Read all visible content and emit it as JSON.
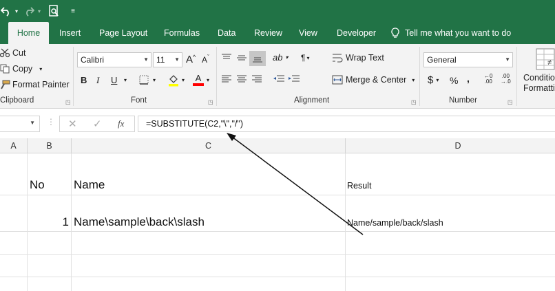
{
  "quick_access": {
    "undo": "undo-icon",
    "redo": "redo-icon",
    "print_preview": "print-preview-icon",
    "customize": "customize-qat-icon"
  },
  "tabs": [
    {
      "label": "Home",
      "active": true
    },
    {
      "label": "Insert"
    },
    {
      "label": "Page Layout"
    },
    {
      "label": "Formulas"
    },
    {
      "label": "Data"
    },
    {
      "label": "Review"
    },
    {
      "label": "View"
    },
    {
      "label": "Developer"
    }
  ],
  "tell_me": "Tell me what you want to do",
  "clipboard": {
    "cut": "Cut",
    "copy": "Copy",
    "format_painter": "Format Painter",
    "label": "Clipboard"
  },
  "font": {
    "name": "Calibri",
    "size": "11",
    "label": "Font"
  },
  "alignment": {
    "wrap_text": "Wrap Text",
    "merge_center": "Merge & Center",
    "label": "Alignment"
  },
  "number": {
    "format": "General",
    "label": "Number"
  },
  "styles": {
    "conditional_line1": "Conditio",
    "conditional_line2": "Formattin"
  },
  "formula_bar": {
    "formula": "=SUBSTITUTE(C2,\"\\\",\"/\")"
  },
  "columns": [
    "A",
    "B",
    "C",
    "D"
  ],
  "rows": [
    {
      "b": "No",
      "c": "Name",
      "d": "Result"
    },
    {
      "b": "1",
      "c": "Name\\sample\\back\\slash",
      "d": "Name/sample/back/slash"
    }
  ],
  "colors": {
    "excel_green": "#217346",
    "ribbon_bg": "#f3f3f3",
    "font_color_bar": "#ff0000",
    "highlight_bar": "#ffff00"
  }
}
